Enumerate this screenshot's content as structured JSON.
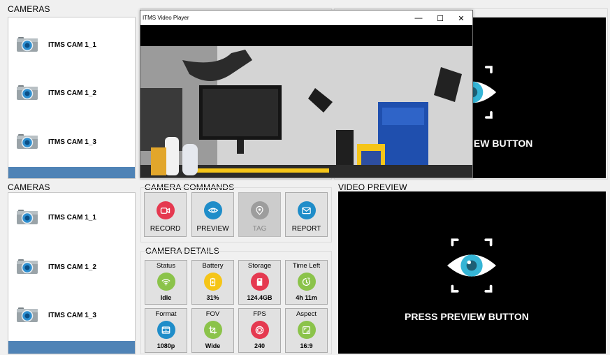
{
  "top": {
    "cameras_title": "CAMERAS",
    "cameras": [
      {
        "label": "ITMS CAM 1_1",
        "icon": "camera-icon"
      },
      {
        "label": "ITMS CAM 1_2",
        "icon": "camera-icon"
      },
      {
        "label": "ITMS CAM 1_3",
        "icon": "camera-icon"
      }
    ],
    "preview_text": "IEW BUTTON"
  },
  "player": {
    "title": "ITMS Video Player",
    "minimize": "—",
    "maximize": "☐",
    "close": "✕"
  },
  "bottom": {
    "cameras_title": "CAMERAS",
    "cameras": [
      {
        "label": "ITMS CAM 1_1",
        "icon": "camera-icon"
      },
      {
        "label": "ITMS CAM 1_2",
        "icon": "camera-icon"
      },
      {
        "label": "ITMS CAM 1_3",
        "icon": "camera-icon"
      }
    ],
    "commands_title": "CAMERA COMMANDS",
    "commands": [
      {
        "label": "RECORD",
        "icon": "record-icon",
        "color": "#e53950",
        "enabled": true
      },
      {
        "label": "PREVIEW",
        "icon": "eye-icon",
        "color": "#1f8dc9",
        "enabled": true
      },
      {
        "label": "TAG",
        "icon": "tag-location-icon",
        "color": "#9d9d9d",
        "enabled": false
      },
      {
        "label": "REPORT",
        "icon": "mail-icon",
        "color": "#1f8dc9",
        "enabled": true
      }
    ],
    "details_title": "CAMERA DETAILS",
    "details": [
      {
        "header": "Status",
        "value": "Idle",
        "icon": "wifi-icon",
        "color": "#8bc34a"
      },
      {
        "header": "Battery",
        "value": "31%",
        "icon": "battery-icon",
        "color": "#f5c518"
      },
      {
        "header": "Storage",
        "value": "124.4GB",
        "icon": "sd-card-icon",
        "color": "#e53950"
      },
      {
        "header": "Time Left",
        "value": "4h 11m",
        "icon": "timer-icon",
        "color": "#8bc34a"
      },
      {
        "header": "Format",
        "value": "1080p",
        "icon": "film-icon",
        "color": "#1f8dc9"
      },
      {
        "header": "FOV",
        "value": "Wide",
        "icon": "crop-icon",
        "color": "#8bc34a"
      },
      {
        "header": "FPS",
        "value": "240",
        "icon": "aperture-icon",
        "color": "#e53950"
      },
      {
        "header": "Aspect",
        "value": "16:9",
        "icon": "aspect-icon",
        "color": "#8bc34a"
      }
    ],
    "preview_title": "VIDEO PREVIEW",
    "preview_text": "PRESS PREVIEW BUTTON"
  },
  "colors": {
    "selected_row": "#4f83b6",
    "eye_iris": "#35b5d6",
    "preview_bg": "#000000"
  }
}
